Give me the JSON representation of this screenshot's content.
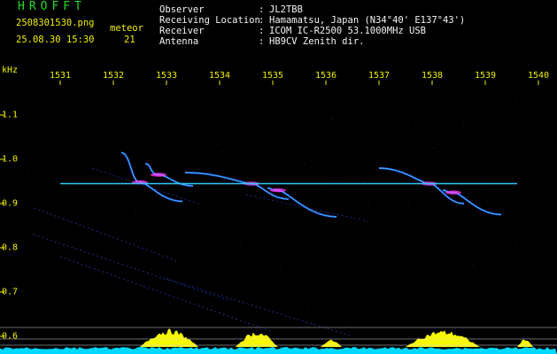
{
  "header": {
    "app_title": "HROFFT",
    "filename": "2508301530.png",
    "datetime": "25.08.30 15:30",
    "meteor_label": "meteor",
    "meteor_count": "21"
  },
  "station_info": [
    {
      "label": "Observer",
      "value": "JL2TBB"
    },
    {
      "label": "Receiving Location",
      "value": "Hamamatsu, Japan (N34°40' E137°43')"
    },
    {
      "label": "Receiver",
      "value": "ICOM IC-R2500 53.1000MHz USB"
    },
    {
      "label": "Antenna",
      "value": "HB9CV Zenith dir."
    }
  ],
  "separator": ":",
  "colors": {
    "header_text": "#f0f000",
    "info_text": "#f4f4f4",
    "title_text": "#22dd22",
    "carrier": "#30c8ff",
    "echo": "#ff40ff",
    "trail": "#3050ff",
    "spectrum_fill": "#00d8ff",
    "activity": "#f8f800"
  },
  "chart_data": {
    "type": "heatmap",
    "ylabel": "kHz",
    "x_tick_labels": [
      "1531",
      "1532",
      "1533",
      "1534",
      "1535",
      "1536",
      "1537",
      "1538",
      "1539",
      "1540"
    ],
    "y_tick_labels": [
      "1.1",
      "1.0",
      "0.9",
      "0.8",
      "0.7",
      "0.6"
    ],
    "x_range": [
      1530.5,
      1540.1
    ],
    "y_range": [
      0.59,
      1.17
    ],
    "carrier_khz": 0.945,
    "carrier_start_minute": 1531.0,
    "carrier_end_minute": 1539.6,
    "echoes": [
      {
        "start": [
          1532.15,
          1.015
        ],
        "end": [
          1533.3,
          0.905
        ],
        "peak": [
          1532.5,
          0.948
        ]
      },
      {
        "start": [
          1532.6,
          0.99
        ],
        "end": [
          1533.5,
          0.94
        ],
        "peak": [
          1532.85,
          0.965
        ]
      },
      {
        "start": [
          1533.35,
          0.97
        ],
        "end": [
          1535.3,
          0.91
        ],
        "peak": [
          1534.6,
          0.945
        ]
      },
      {
        "start": [
          1534.9,
          0.935
        ],
        "end": [
          1536.2,
          0.87
        ],
        "peak": [
          1535.1,
          0.93
        ]
      },
      {
        "start": [
          1537.0,
          0.98
        ],
        "end": [
          1538.6,
          0.9
        ],
        "peak": [
          1537.95,
          0.945
        ]
      },
      {
        "start": [
          1538.2,
          0.93
        ],
        "end": [
          1539.3,
          0.875
        ],
        "peak": [
          1538.4,
          0.925
        ]
      }
    ],
    "faint_trails": [
      {
        "start": [
          1530.5,
          0.89
        ],
        "end": [
          1533.2,
          0.77
        ]
      },
      {
        "start": [
          1530.5,
          0.83
        ],
        "end": [
          1534.2,
          0.68
        ]
      },
      {
        "start": [
          1531.0,
          0.78
        ],
        "end": [
          1535.0,
          0.61
        ]
      },
      {
        "start": [
          1533.0,
          0.73
        ],
        "end": [
          1536.5,
          0.6
        ]
      },
      {
        "start": [
          1531.6,
          0.98
        ],
        "end": [
          1533.6,
          0.9
        ]
      },
      {
        "start": [
          1534.5,
          0.92
        ],
        "end": [
          1536.8,
          0.86
        ]
      }
    ],
    "activity_bursts": [
      {
        "start": 1532.5,
        "end": 1533.6,
        "level": 0.85
      },
      {
        "start": 1534.3,
        "end": 1535.1,
        "level": 0.75
      },
      {
        "start": 1535.9,
        "end": 1536.3,
        "level": 0.35
      },
      {
        "start": 1537.5,
        "end": 1538.9,
        "level": 0.8
      },
      {
        "start": 1539.6,
        "end": 1539.9,
        "level": 0.4
      }
    ]
  }
}
